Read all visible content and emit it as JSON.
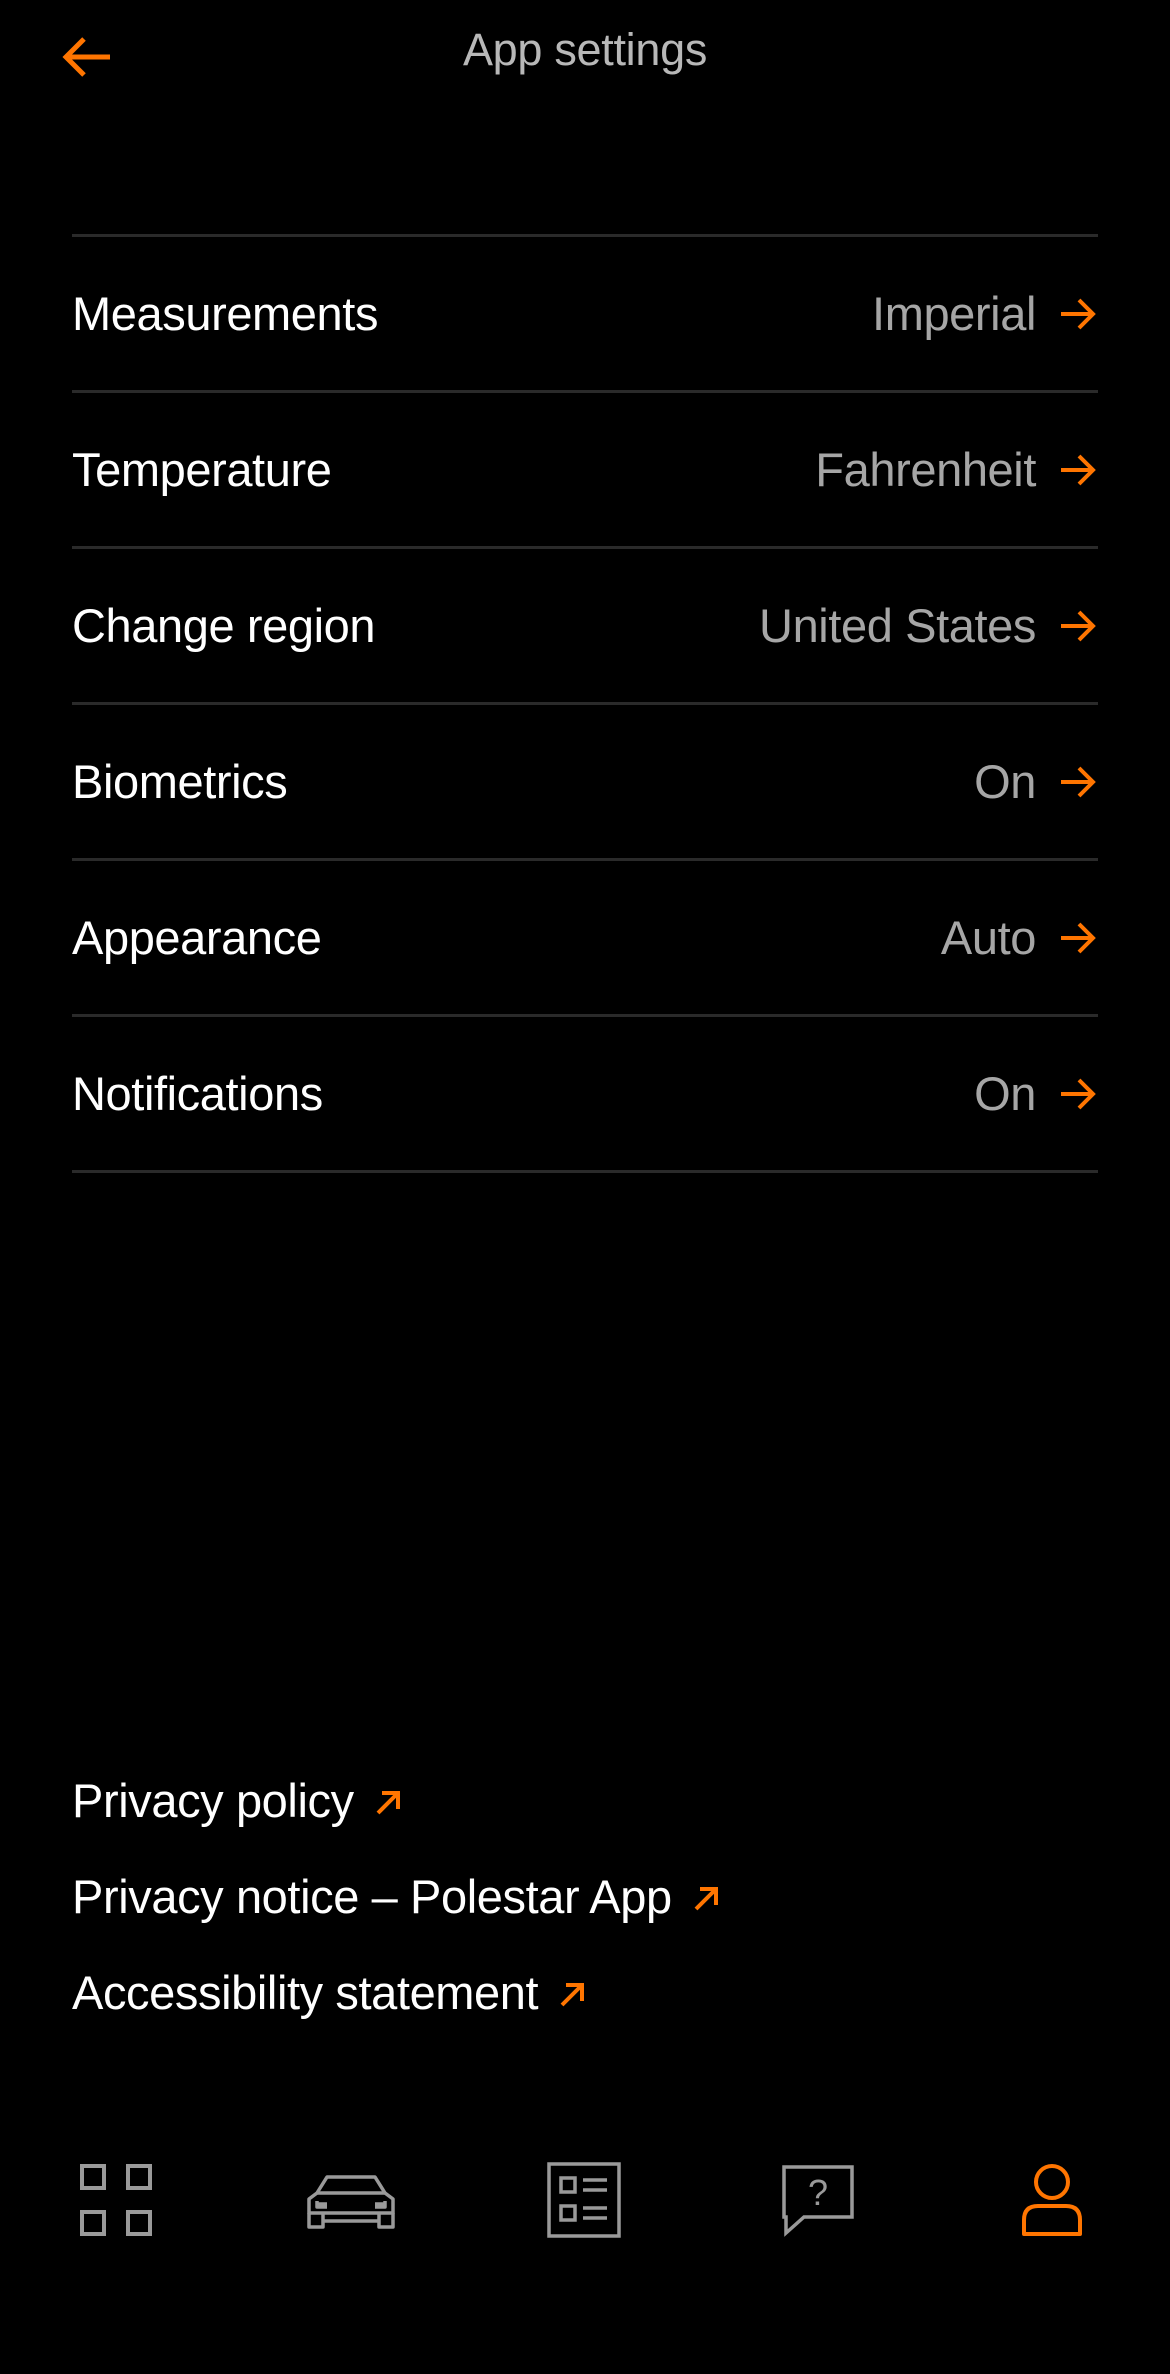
{
  "header": {
    "title": "App settings",
    "back_icon": "arrow-left-icon"
  },
  "colors": {
    "accent": "#ff7500",
    "background": "#000000",
    "divider": "#2a2a2a",
    "value_text": "#a6a6a6",
    "title_text": "#b8b8b8"
  },
  "settings": [
    {
      "label": "Measurements",
      "value": "Imperial",
      "icon": "arrow-right-icon"
    },
    {
      "label": "Temperature",
      "value": "Fahrenheit",
      "icon": "arrow-right-icon"
    },
    {
      "label": "Change region",
      "value": "United States",
      "icon": "arrow-right-icon"
    },
    {
      "label": "Biometrics",
      "value": "On",
      "icon": "arrow-right-icon"
    },
    {
      "label": "Appearance",
      "value": "Auto",
      "icon": "arrow-right-icon"
    },
    {
      "label": "Notifications",
      "value": "On",
      "icon": "arrow-right-icon"
    }
  ],
  "links": [
    {
      "label": "Privacy policy",
      "icon": "external-link-icon"
    },
    {
      "label": "Privacy notice – Polestar App",
      "icon": "external-link-icon"
    },
    {
      "label": "Accessibility statement",
      "icon": "external-link-icon"
    }
  ],
  "bottom_nav": [
    {
      "name": "dashboard",
      "icon": "grid-icon",
      "active": false
    },
    {
      "name": "car",
      "icon": "car-icon",
      "active": false
    },
    {
      "name": "checklist",
      "icon": "checklist-icon",
      "active": false
    },
    {
      "name": "support",
      "icon": "help-chat-icon",
      "active": false
    },
    {
      "name": "profile",
      "icon": "person-icon",
      "active": true
    }
  ]
}
